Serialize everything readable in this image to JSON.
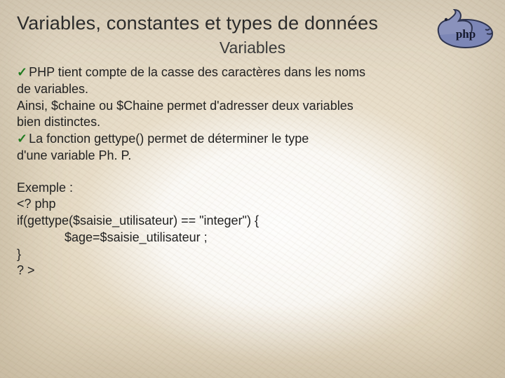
{
  "title": "Variables, constantes et types de données",
  "subtitle": "Variables",
  "bullets": {
    "b1_l1": "PHP tient compte de la casse des caractères dans les noms",
    "b1_l2": "de variables.",
    "b1_l3": "Ainsi, $chaine ou $Chaine permet d'adresser deux variables",
    "b1_l4": "bien distinctes.",
    "b2_l1": "La fonction gettype() permet de déterminer le type",
    "b2_l2": "d'une variable Ph. P."
  },
  "example": {
    "heading": "Exemple :",
    "l1": "<? php",
    "l2": "if(gettype($saisie_utilisateur) == \"integer\") {",
    "l3": "$age=$saisie_utilisateur ;",
    "l4": "}",
    "l5": "? >"
  },
  "logo": {
    "text": "php"
  }
}
